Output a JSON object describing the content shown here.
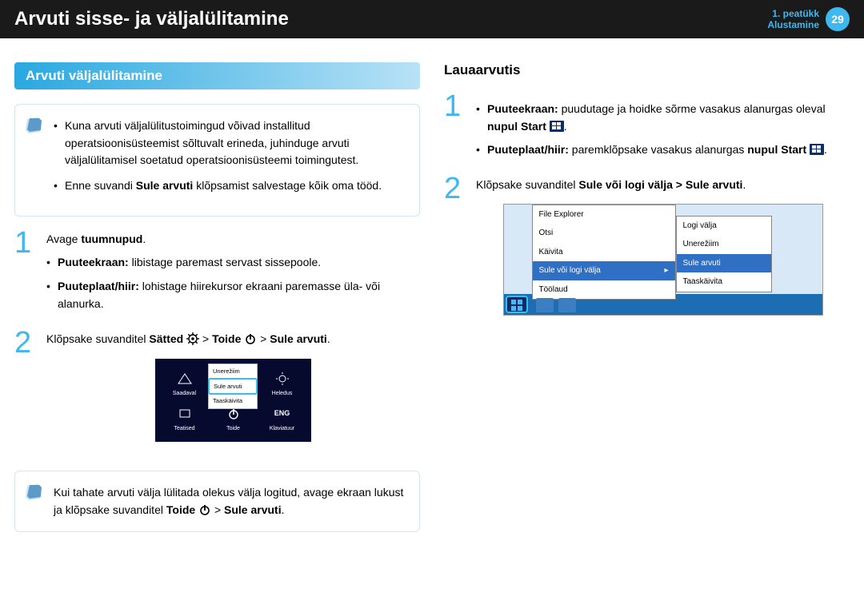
{
  "header": {
    "title": "Arvuti sisse- ja väljalülitamine",
    "chapter_line1": "1. peatükk",
    "chapter_line2": "Alustamine",
    "page_num": "29"
  },
  "left": {
    "section_title": "Arvuti väljalülitamine",
    "note1_a": "Kuna arvuti väljalülitustoimingud võivad installitud operatsioonisüsteemist sõltuvalt erineda, juhinduge arvuti väljalülitamisel soetatud operatsioonisüsteemi toimingutest.",
    "note1_b_pre": "Enne suvandi ",
    "note1_b_bold": "Sule arvuti",
    "note1_b_post": " klõpsamist salvestage kõik oma tööd.",
    "step1_num": "1",
    "step1_pre": "Avage ",
    "step1_bold": "tuumnupud",
    "step1_post": ".",
    "step1_b1_bold": "Puuteekraan:",
    "step1_b1_rest": " libistage paremast servast sissepoole.",
    "step1_b2_bold": "Puuteplaat/hiir:",
    "step1_b2_rest": " lohistage hiirekursor ekraani paremasse üla- või alanurka.",
    "step2_num": "2",
    "step2_pre": "Klõpsake suvanditel ",
    "step2_b1": "Sätted",
    "step2_mid1": " > ",
    "step2_b2": "Toide",
    "step2_mid2": " > ",
    "step2_b3": "Sule arvuti",
    "step2_post": ".",
    "charms": {
      "c1": "Saadaval",
      "c2": "Heledus",
      "c3": "Teatised",
      "c4": "Toide",
      "c5": "Klaviatuur",
      "eng": "ENG",
      "m1": "Unerežiim",
      "m2": "Sule arvuti",
      "m3": "Taaskäivita"
    },
    "note2_pre": "Kui tahate arvuti välja lülitada olekus välja logitud, avage ekraan lukust ja klõpsake suvanditel ",
    "note2_bold": "Toide",
    "note2_mid": " > ",
    "note2_bold2": "Sule arvuti",
    "note2_post": "."
  },
  "right": {
    "section_title": "Lauaarvutis",
    "step1_num": "1",
    "step1_b1_bold": "Puuteekraan:",
    "step1_b1_rest_a": " puudutage ja hoidke sõrme vasakus alanurgas oleval ",
    "step1_b1_rest_b": "nupul Start",
    "step1_b1_rest_c": ".",
    "step1_b2_bold": "Puuteplaat/hiir:",
    "step1_b2_rest_a": " paremklõpsake vasakus alanurgas ",
    "step1_b2_rest_b": "nupul Start",
    "step1_b2_rest_c": ".",
    "step2_num": "2",
    "step2_pre": "Klõpsake suvanditel ",
    "step2_bold": "Sule või logi välja > Sule arvuti",
    "step2_post": ".",
    "sm": {
      "i1": "File Explorer",
      "i2": "Otsi",
      "i3": "Käivita",
      "i4": "Sule või logi välja",
      "i5": "Töölaud",
      "s1": "Logi välja",
      "s2": "Unerežiim",
      "s3": "Sule arvuti",
      "s4": "Taaskäivita"
    }
  }
}
